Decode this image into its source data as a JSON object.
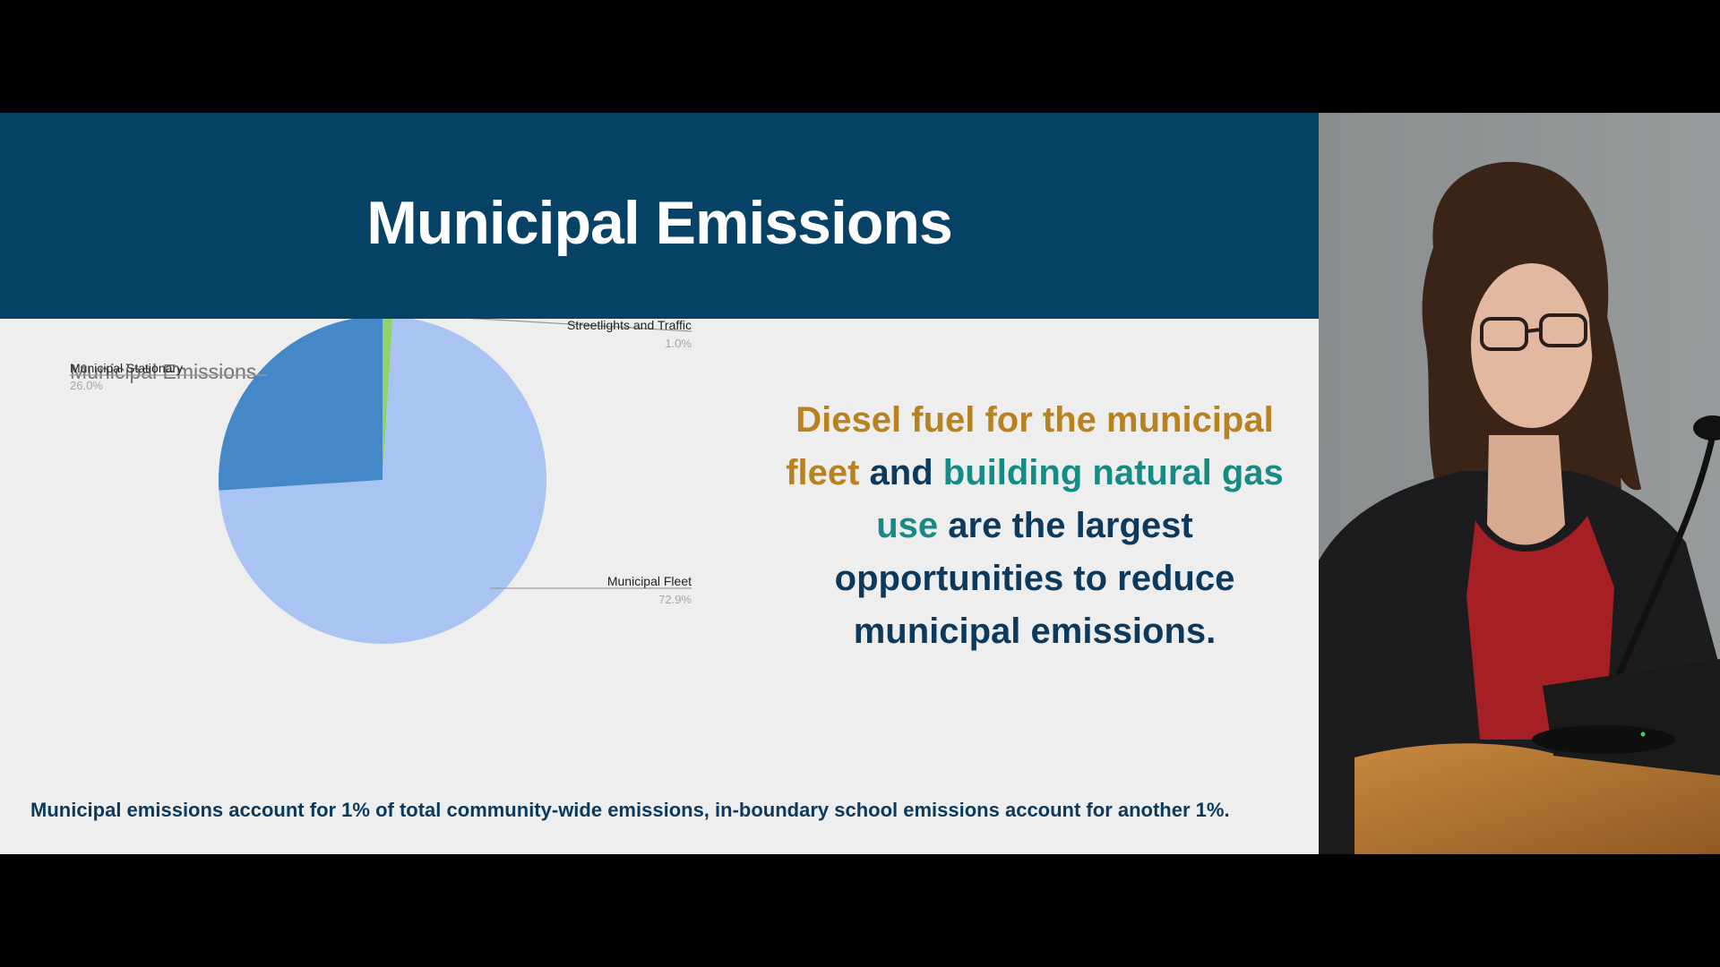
{
  "slide": {
    "title": "Municipal Emissions",
    "callout": {
      "part1": "Diesel fuel for the municipal fleet",
      "part2": " and ",
      "part3": "building natural gas use",
      "part4": " are the largest opportunities to reduce municipal emissions."
    },
    "footnote": "Municipal emissions account for 1% of total community-wide emissions, in-boundary school emissions account for another 1%.",
    "colors": {
      "header": "#064166",
      "slide_bg": "#eeeeee",
      "text_navy": "#0d3a5c",
      "highlight_gold": "#b7821f",
      "highlight_teal": "#168b83"
    }
  },
  "chart_data": {
    "type": "pie",
    "title": "Municipal Emissions",
    "slices": [
      {
        "label": "Streetlights and Traffic",
        "value": 1.0,
        "display": "1.0%",
        "color": "#8fd16c"
      },
      {
        "label": "Municipal Fleet",
        "value": 72.9,
        "display": "72.9%",
        "color": "#a9c4f2"
      },
      {
        "label": "Municipal Stationary",
        "value": 26.0,
        "display": "26.0%",
        "color": "#4588c8"
      }
    ]
  }
}
